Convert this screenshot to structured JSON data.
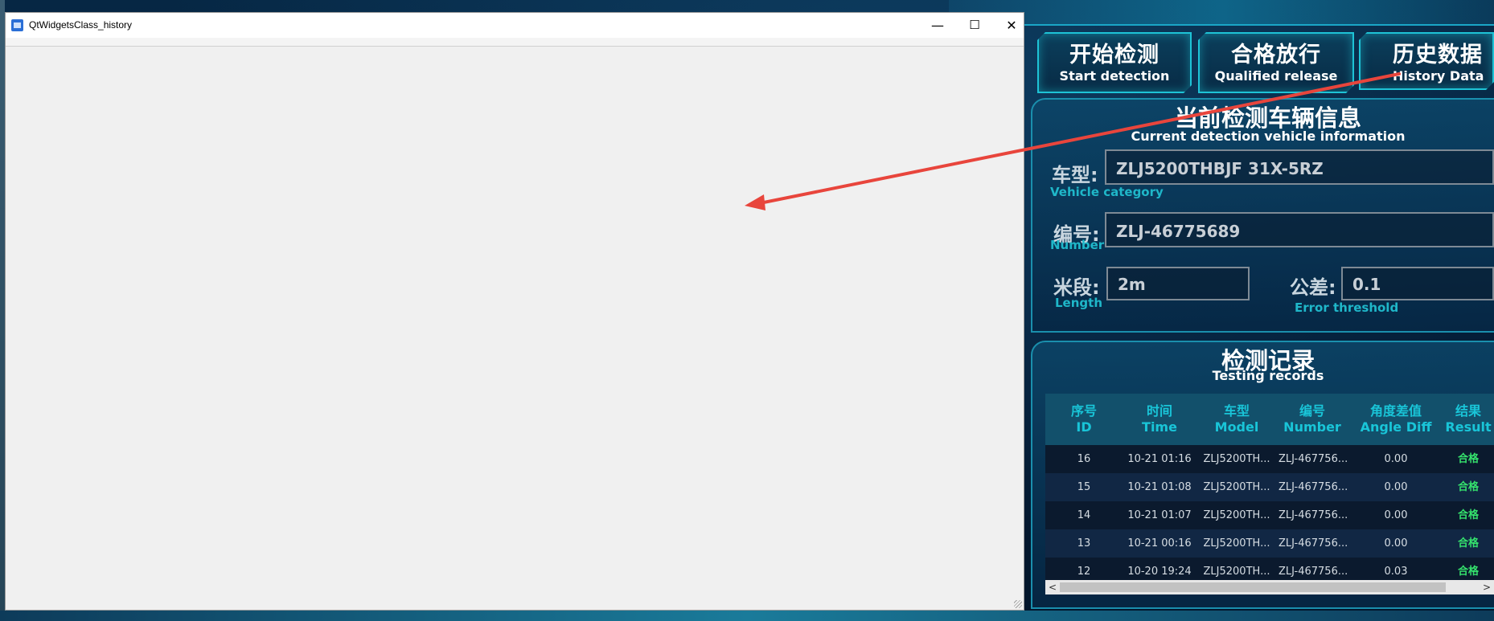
{
  "window": {
    "title": "QtWidgetsClass_history",
    "minimize": "—",
    "maximize": "☐",
    "close": "✕"
  },
  "dashboard": {
    "buttons": [
      {
        "zh": "开始检测",
        "en": "Start detection"
      },
      {
        "zh": "合格放行",
        "en": "Qualified release"
      },
      {
        "zh": "历史数据",
        "en": "History Data"
      }
    ],
    "vehicle_panel": {
      "title_zh": "当前检测车辆信息",
      "title_en": "Current detection vehicle information",
      "model_label_zh": "车型:",
      "model_label_en": "Vehicle category",
      "model_value": "ZLJ5200THBJF 31X-5RZ",
      "number_label_zh": "编号:",
      "number_label_en": "Number",
      "number_value": "ZLJ-46775689",
      "length_label_zh": "米段:",
      "length_label_en": "Length",
      "length_value": "2m",
      "tolerance_label_zh": "公差:",
      "tolerance_label_en": "Error threshold",
      "tolerance_value": "0.1"
    },
    "records_panel": {
      "title_zh": "检测记录",
      "title_en": "Testing records",
      "headers": [
        {
          "zh": "序号",
          "en": "ID"
        },
        {
          "zh": "时间",
          "en": "Time"
        },
        {
          "zh": "车型",
          "en": "Model"
        },
        {
          "zh": "编号",
          "en": "Number"
        },
        {
          "zh": "角度差值",
          "en": "Angle Diff"
        },
        {
          "zh": "结果",
          "en": "Result"
        }
      ],
      "rows": [
        {
          "id": "16",
          "time": "10-21 01:16",
          "model": "ZLJ5200TH...",
          "number": "ZLJ-467756...",
          "angle": "0.00",
          "result": "合格"
        },
        {
          "id": "15",
          "time": "10-21 01:08",
          "model": "ZLJ5200TH...",
          "number": "ZLJ-467756...",
          "angle": "0.00",
          "result": "合格"
        },
        {
          "id": "14",
          "time": "10-21 01:07",
          "model": "ZLJ5200TH...",
          "number": "ZLJ-467756...",
          "angle": "0.00",
          "result": "合格"
        },
        {
          "id": "13",
          "time": "10-21 00:16",
          "model": "ZLJ5200TH...",
          "number": "ZLJ-467756...",
          "angle": "0.00",
          "result": "合格"
        },
        {
          "id": "12",
          "time": "10-20 19:24",
          "model": "ZLJ5200TH...",
          "number": "ZLJ-467756...",
          "angle": "0.03",
          "result": "合格"
        }
      ]
    },
    "scroll_left": "<",
    "scroll_right": ">"
  },
  "colors": {
    "accent": "#1ec3d6",
    "label_cyan": "#1fb7c9",
    "pass_green": "#35e36d",
    "annotation_red": "#e8453c"
  }
}
